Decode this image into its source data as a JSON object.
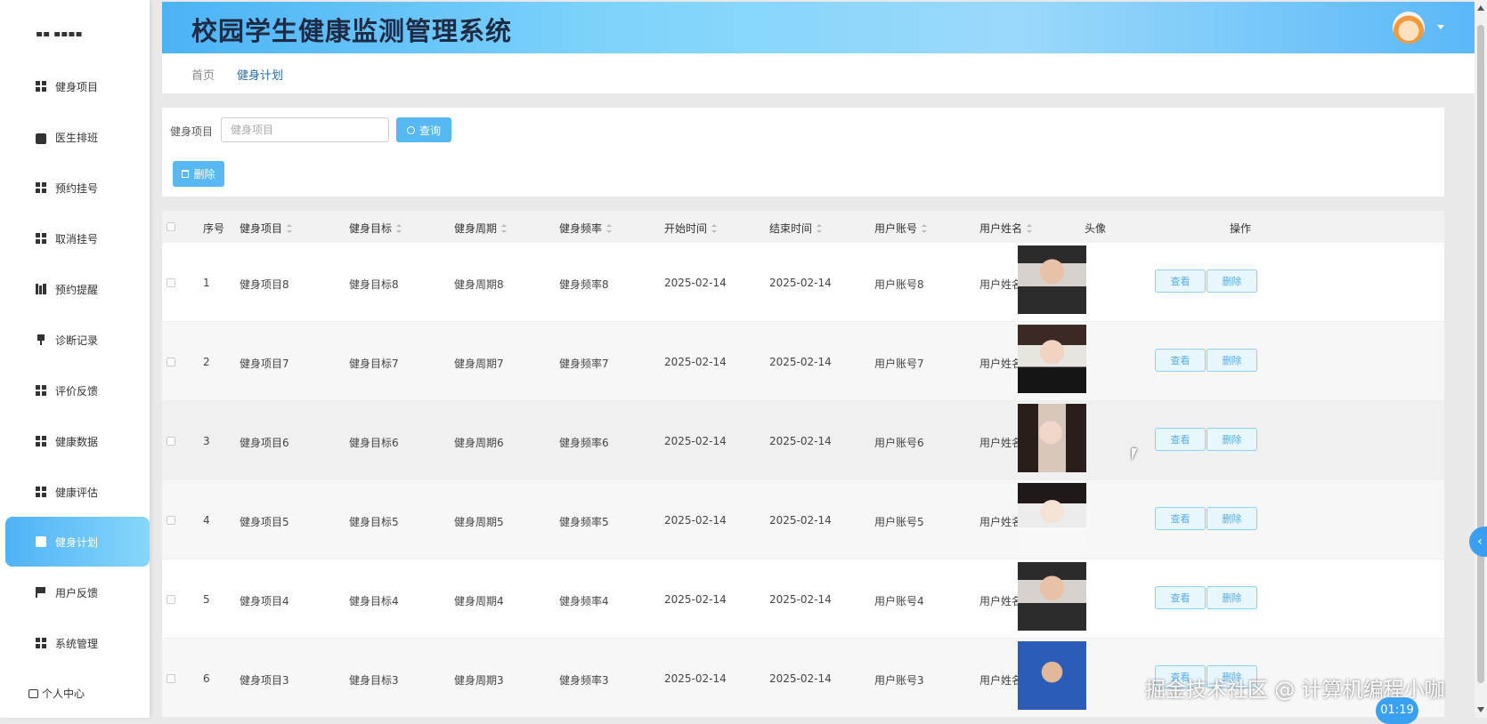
{
  "app": {
    "title": "校园学生健康监测管理系统"
  },
  "sidebar": {
    "items": [
      {
        "label": "健身项目",
        "icon": "grid-icon"
      },
      {
        "label": "医生排班",
        "icon": "briefcase-icon"
      },
      {
        "label": "预约挂号",
        "icon": "grid-icon"
      },
      {
        "label": "取消挂号",
        "icon": "grid-icon"
      },
      {
        "label": "预约提醒",
        "icon": "bar-chart-icon"
      },
      {
        "label": "诊断记录",
        "icon": "stamp-icon"
      },
      {
        "label": "评价反馈",
        "icon": "grid-icon"
      },
      {
        "label": "健康数据",
        "icon": "grid-icon"
      },
      {
        "label": "健康评估",
        "icon": "grid-icon"
      },
      {
        "label": "健身计划",
        "icon": "clipboard-icon",
        "active": true
      },
      {
        "label": "用户反馈",
        "icon": "flag-icon"
      },
      {
        "label": "系统管理",
        "icon": "grid-icon"
      }
    ],
    "user_center": "个人中心",
    "active_color": "#4fb2f6"
  },
  "breadcrumb": {
    "home": "首页",
    "current": "健身计划"
  },
  "search": {
    "label": "健身项目",
    "placeholder": "健身项目",
    "query_button": "查询",
    "delete_button": "删除"
  },
  "table": {
    "columns": [
      "序号",
      "健身项目",
      "健身目标",
      "健身周期",
      "健身频率",
      "开始时间",
      "结束时间",
      "用户账号",
      "用户姓名",
      "头像",
      "操作"
    ],
    "view_label": "查看",
    "delete_label": "删除",
    "rows": [
      {
        "index": "1",
        "project": "健身项目8",
        "goal": "健身目标8",
        "cycle": "健身周期8",
        "frequency": "健身频率8",
        "start": "2025-02-14",
        "end": "2025-02-14",
        "account": "用户账号8",
        "name": "用户姓名8"
      },
      {
        "index": "2",
        "project": "健身项目7",
        "goal": "健身目标7",
        "cycle": "健身周期7",
        "frequency": "健身频率7",
        "start": "2025-02-14",
        "end": "2025-02-14",
        "account": "用户账号7",
        "name": "用户姓名7"
      },
      {
        "index": "3",
        "project": "健身项目6",
        "goal": "健身目标6",
        "cycle": "健身周期6",
        "frequency": "健身频率6",
        "start": "2025-02-14",
        "end": "2025-02-14",
        "account": "用户账号6",
        "name": "用户姓名6"
      },
      {
        "index": "4",
        "project": "健身项目5",
        "goal": "健身目标5",
        "cycle": "健身周期5",
        "frequency": "健身频率5",
        "start": "2025-02-14",
        "end": "2025-02-14",
        "account": "用户账号5",
        "name": "用户姓名5"
      },
      {
        "index": "5",
        "project": "健身项目4",
        "goal": "健身目标4",
        "cycle": "健身周期4",
        "frequency": "健身频率4",
        "start": "2025-02-14",
        "end": "2025-02-14",
        "account": "用户账号4",
        "name": "用户姓名4"
      },
      {
        "index": "6",
        "project": "健身项目3",
        "goal": "健身目标3",
        "cycle": "健身周期3",
        "frequency": "健身频率3",
        "start": "2025-02-14",
        "end": "2025-02-14",
        "account": "用户账号3",
        "name": "用户姓名3"
      }
    ]
  },
  "overlay": {
    "watermark": "掘金技术社区 @ 计算机编程小咖",
    "timer": "01:19"
  },
  "colors": {
    "accent": "#58b8f3",
    "header_start": "#4bb3f5",
    "header_end": "#9ad9fb"
  }
}
